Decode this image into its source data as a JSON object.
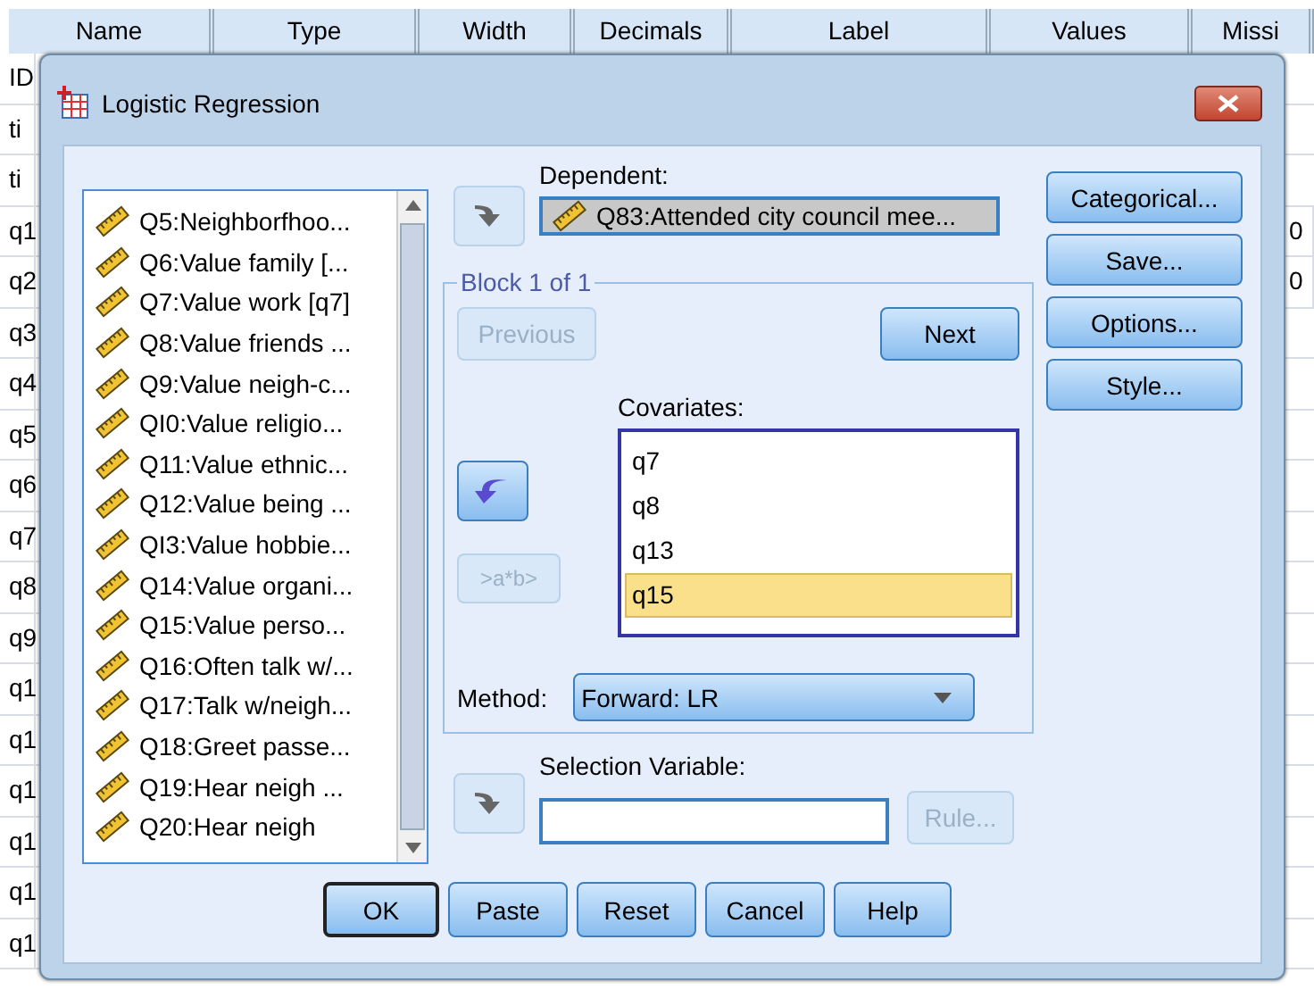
{
  "grid": {
    "columns": [
      "Name",
      "Type",
      "Width",
      "Decimals",
      "Label",
      "Values",
      "Missi"
    ],
    "rows": [
      {
        "name": "ID",
        "missing": ""
      },
      {
        "name": "ti",
        "missing": ""
      },
      {
        "name": "ti",
        "missing": ""
      },
      {
        "name": "q1",
        "missing": "0"
      },
      {
        "name": "q2",
        "missing": "0"
      },
      {
        "name": "q3",
        "missing": ""
      },
      {
        "name": "q4",
        "missing": ""
      },
      {
        "name": "q5",
        "missing": ""
      },
      {
        "name": "q6",
        "missing": ""
      },
      {
        "name": "q7",
        "missing": ""
      },
      {
        "name": "q8",
        "missing": ""
      },
      {
        "name": "q9",
        "missing": ""
      },
      {
        "name": "q1",
        "missing": ""
      },
      {
        "name": "q1",
        "missing": ""
      },
      {
        "name": "q1",
        "missing": ""
      },
      {
        "name": "q1",
        "missing": ""
      },
      {
        "name": "q1",
        "missing": ""
      },
      {
        "name": "q1",
        "missing": ""
      }
    ]
  },
  "dialog": {
    "title": "Logistic Regression",
    "variables": [
      "Q5:Neighborfhoo...",
      "Q6:Value family [...",
      "Q7:Value work [q7]",
      "Q8:Value friends ...",
      "Q9:Value neigh-c...",
      "QI0:Value religio...",
      "Q11:Value ethnic...",
      "Q12:Value being ...",
      "QI3:Value hobbie...",
      "Q14:Value organi...",
      "Q15:Value perso...",
      "Q16:Often talk w/...",
      "Q17:Talk w/neigh...",
      "Q18:Greet passe...",
      "Q19:Hear neigh ...",
      "Q20:Hear neigh"
    ],
    "dependent": {
      "label": "Dependent:",
      "value": "Q83:Attended city council mee..."
    },
    "block": {
      "title": "Block 1 of 1",
      "previous": {
        "label": "Previous",
        "disabled": true
      },
      "next": {
        "label": "Next",
        "disabled": false
      },
      "covariates_label": "Covariates:",
      "covariates": [
        {
          "label": "q7",
          "selected": false
        },
        {
          "label": "q8",
          "selected": false
        },
        {
          "label": "q13",
          "selected": false
        },
        {
          "label": "q15",
          "selected": true
        }
      ],
      "interaction": {
        "label": ">a*b>",
        "disabled": true
      },
      "method_label": "Method:",
      "method": "Forward: LR"
    },
    "selection": {
      "label": "Selection Variable:",
      "rule": {
        "label": "Rule...",
        "disabled": true
      }
    },
    "side_buttons": [
      "Categorical...",
      "Save...",
      "Options...",
      "Style..."
    ],
    "bottom_buttons": [
      {
        "label": "OK",
        "default": true
      },
      {
        "label": "Paste",
        "default": false
      },
      {
        "label": "Reset",
        "default": false
      },
      {
        "label": "Cancel",
        "default": false
      },
      {
        "label": "Help",
        "default": false
      }
    ]
  }
}
